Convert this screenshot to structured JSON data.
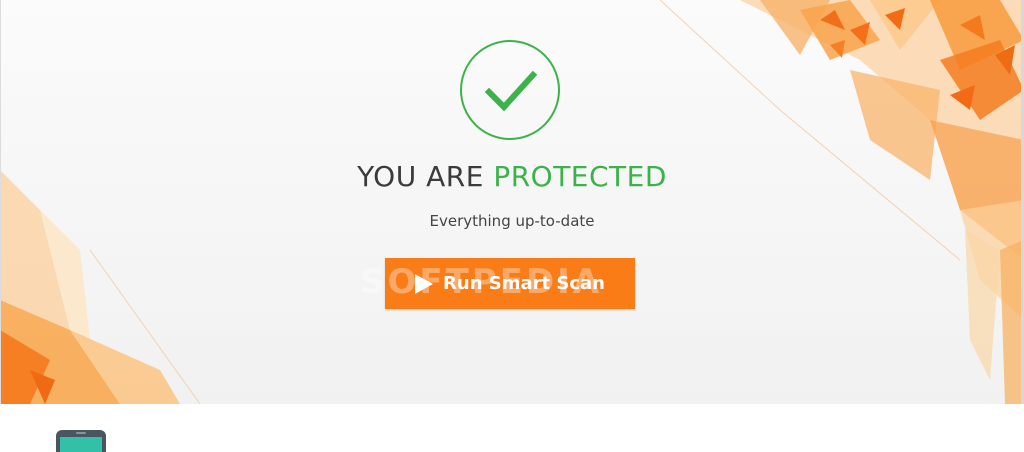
{
  "status": {
    "headline_prefix": "YOU ARE ",
    "headline_accent": "PROTECTED",
    "subtitle": "Everything up-to-date",
    "icon": "checkmark-circle-icon",
    "accent_color": "#3cb34a"
  },
  "actions": {
    "scan_button_label": "Run Smart Scan",
    "scan_button_color": "#f97c17",
    "scan_button_icon": "play-icon"
  },
  "watermark": "SOFTPEDIA",
  "bottom_panel": {
    "icon": "mobile-device-icon"
  }
}
